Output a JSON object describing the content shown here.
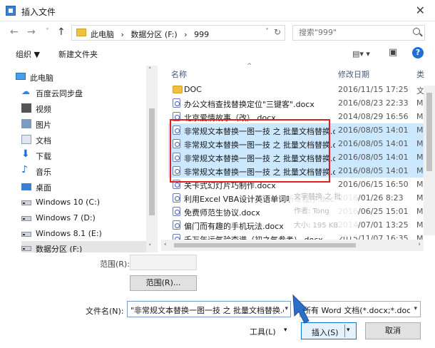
{
  "window": {
    "title": "插入文件",
    "close_glyph": "✕"
  },
  "address": {
    "crumbs": [
      "此电脑",
      "›",
      "数据分区 (F:)",
      "›",
      "999"
    ],
    "dropdown_glyph": "˅",
    "refresh_glyph": "↻"
  },
  "nav_glyphs": {
    "back": "←",
    "forward": "→",
    "recent": "˅",
    "up": "↑"
  },
  "search": {
    "placeholder": "搜索\"999\""
  },
  "toolbar": {
    "organize": "组织 ▼",
    "new_folder": "新建文件夹",
    "view_glyph": "▤▾ ▾",
    "preview_glyph": "▣",
    "help": "?"
  },
  "sidebar": {
    "items": [
      {
        "label": "此电脑",
        "icon": "computer-icon"
      },
      {
        "label": "百度云同步盘",
        "icon": "cloud-icon"
      },
      {
        "label": "视频",
        "icon": "video-icon"
      },
      {
        "label": "图片",
        "icon": "picture-icon"
      },
      {
        "label": "文档",
        "icon": "document-icon"
      },
      {
        "label": "下载",
        "icon": "download-icon"
      },
      {
        "label": "音乐",
        "icon": "music-icon"
      },
      {
        "label": "桌面",
        "icon": "desktop-icon"
      },
      {
        "label": "Windows 10 (C:)",
        "icon": "drive-icon"
      },
      {
        "label": "Windows 7 (D:)",
        "icon": "drive-icon"
      },
      {
        "label": "Windows 8.1 (E:)",
        "icon": "drive-icon"
      },
      {
        "label": "数据分区 (F:)",
        "icon": "drive-icon"
      }
    ],
    "glyphs": {
      "cloud": "☁",
      "down": "⬇",
      "music": "♪"
    }
  },
  "files": {
    "columns": {
      "name": "名称",
      "date": "修改日期",
      "type": "类"
    },
    "sort_glyph": "^",
    "rows": [
      {
        "name": "DOC",
        "date": "2016/11/15 17:25",
        "type": "文",
        "kind": "folder"
      },
      {
        "name": "办公文档查找替换定位\"三键客\".docx",
        "date": "2016/08/23 22:33",
        "type": "M"
      },
      {
        "name": "北京爱情故事（改）.docx",
        "date": "2014/08/29 16:56",
        "type": "M"
      },
      {
        "name": "非常规文本替换一图一技 之 批量文档替换.docx",
        "date": "2016/08/05 14:01",
        "type": "M",
        "selected": true
      },
      {
        "name": "非常规文本替换一图一技 之 批量文档替换.docx",
        "date": "2016/08/05 14:01",
        "type": "M",
        "selected": true
      },
      {
        "name": "非常规文本替换一图一技 之 批量文档替换.docx",
        "date": "2016/08/05 14:01",
        "type": "M",
        "selected": true
      },
      {
        "name": "非常规文本替换一图一技 之 批量文档替换.docx",
        "date": "2016/08/05 14:01",
        "type": "M",
        "selected": true
      },
      {
        "name": "关卡式幻灯片巧制作.docx",
        "date": "2016/06/15 16:50",
        "type": "M"
      },
      {
        "name": "利用Excel VBA设计英语单词听写程序.docx",
        "date": "2016/01/26 8:23",
        "type": "M"
      },
      {
        "name": "免费师范生协议.docx",
        "date": "2016/06/25 15:01",
        "type": "M"
      },
      {
        "name": "偏门而有趣的手机玩法.docx",
        "date": "2014/07/01 13:25",
        "type": "M"
      },
      {
        "name": "千万年运气验查谱（初之气参考）.docx",
        "date": "2015/11/07 16:35",
        "type": "M"
      }
    ],
    "tooltip": {
      "line1": "文字替换 之 批",
      "line2": "作者: Tong",
      "line3": "大小: 195 KB"
    }
  },
  "scroll_glyphs": {
    "up": "˄",
    "down": "˅",
    "left": "‹",
    "right": "›"
  },
  "footer": {
    "range_label": "范围(R):",
    "range_button": "范围(R)...",
    "filename_label": "文件名(N):",
    "filename_value": "\"非常规文本替换一图一技 之 批量文档替换.docx\"",
    "filetype_value": "所有 Word 文档(*.docx;*.docm",
    "dd_glyph": "▾",
    "tools": "工具(L)",
    "insert": "插入(S)",
    "cancel": "取消"
  }
}
